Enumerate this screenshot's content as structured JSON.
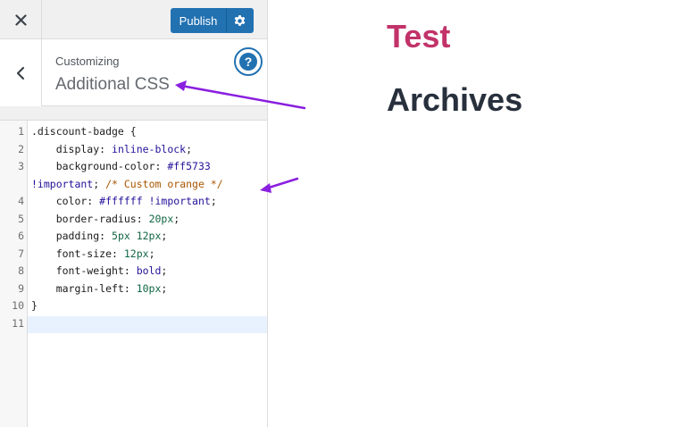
{
  "topbar": {
    "publish_label": "Publish",
    "close_icon": "close-icon",
    "settings_icon": "gear-icon"
  },
  "section": {
    "customizing_label": "Customizing",
    "title": "Additional CSS",
    "back_icon": "chevron-left-icon",
    "help_icon": "help-icon",
    "help_glyph": "?"
  },
  "editor": {
    "line_numbers": [
      "1",
      "2",
      "3",
      "4",
      "5",
      "6",
      "7",
      "8",
      "9",
      "10",
      "11"
    ],
    "lines": [
      [
        {
          "t": ".discount-badge {",
          "c": "punc"
        }
      ],
      [
        {
          "t": "    display: ",
          "c": "prop"
        },
        {
          "t": "inline-block",
          "c": "val"
        },
        {
          "t": ";",
          "c": "punc"
        }
      ],
      [
        {
          "t": "    background-color: ",
          "c": "prop"
        },
        {
          "t": "#ff5733",
          "c": "color"
        }
      ],
      [
        {
          "t": "!important",
          "c": "imp"
        },
        {
          "t": "; ",
          "c": "punc"
        },
        {
          "t": "/* Custom orange */",
          "c": "cmt"
        }
      ],
      [
        {
          "t": "    color: ",
          "c": "prop"
        },
        {
          "t": "#ffffff",
          "c": "color"
        },
        {
          "t": " ",
          "c": "punc"
        },
        {
          "t": "!important",
          "c": "imp"
        },
        {
          "t": ";",
          "c": "punc"
        }
      ],
      [
        {
          "t": "    border-radius: ",
          "c": "prop"
        },
        {
          "t": "20px",
          "c": "num"
        },
        {
          "t": ";",
          "c": "punc"
        }
      ],
      [
        {
          "t": "    padding: ",
          "c": "prop"
        },
        {
          "t": "5px 12px",
          "c": "num"
        },
        {
          "t": ";",
          "c": "punc"
        }
      ],
      [
        {
          "t": "    font-size: ",
          "c": "prop"
        },
        {
          "t": "12px",
          "c": "num"
        },
        {
          "t": ";",
          "c": "punc"
        }
      ],
      [
        {
          "t": "    font-weight: ",
          "c": "prop"
        },
        {
          "t": "bold",
          "c": "val"
        },
        {
          "t": ";",
          "c": "punc"
        }
      ],
      [
        {
          "t": "    margin-left: ",
          "c": "prop"
        },
        {
          "t": "10px",
          "c": "num"
        },
        {
          "t": ";",
          "c": "punc"
        }
      ],
      [
        {
          "t": "}",
          "c": "punc"
        }
      ],
      [
        {
          "t": "",
          "c": "punc"
        }
      ]
    ],
    "line_number_for_row": [
      "1",
      "2",
      "3",
      "",
      "4",
      "5",
      "6",
      "7",
      "8",
      "9",
      "10",
      "11"
    ]
  },
  "preview": {
    "site_title": "Test",
    "page_heading": "Archives"
  },
  "colors": {
    "accent": "#2271b1",
    "site_title": "#c2336a",
    "annotation_arrow": "#8a1fe0"
  }
}
